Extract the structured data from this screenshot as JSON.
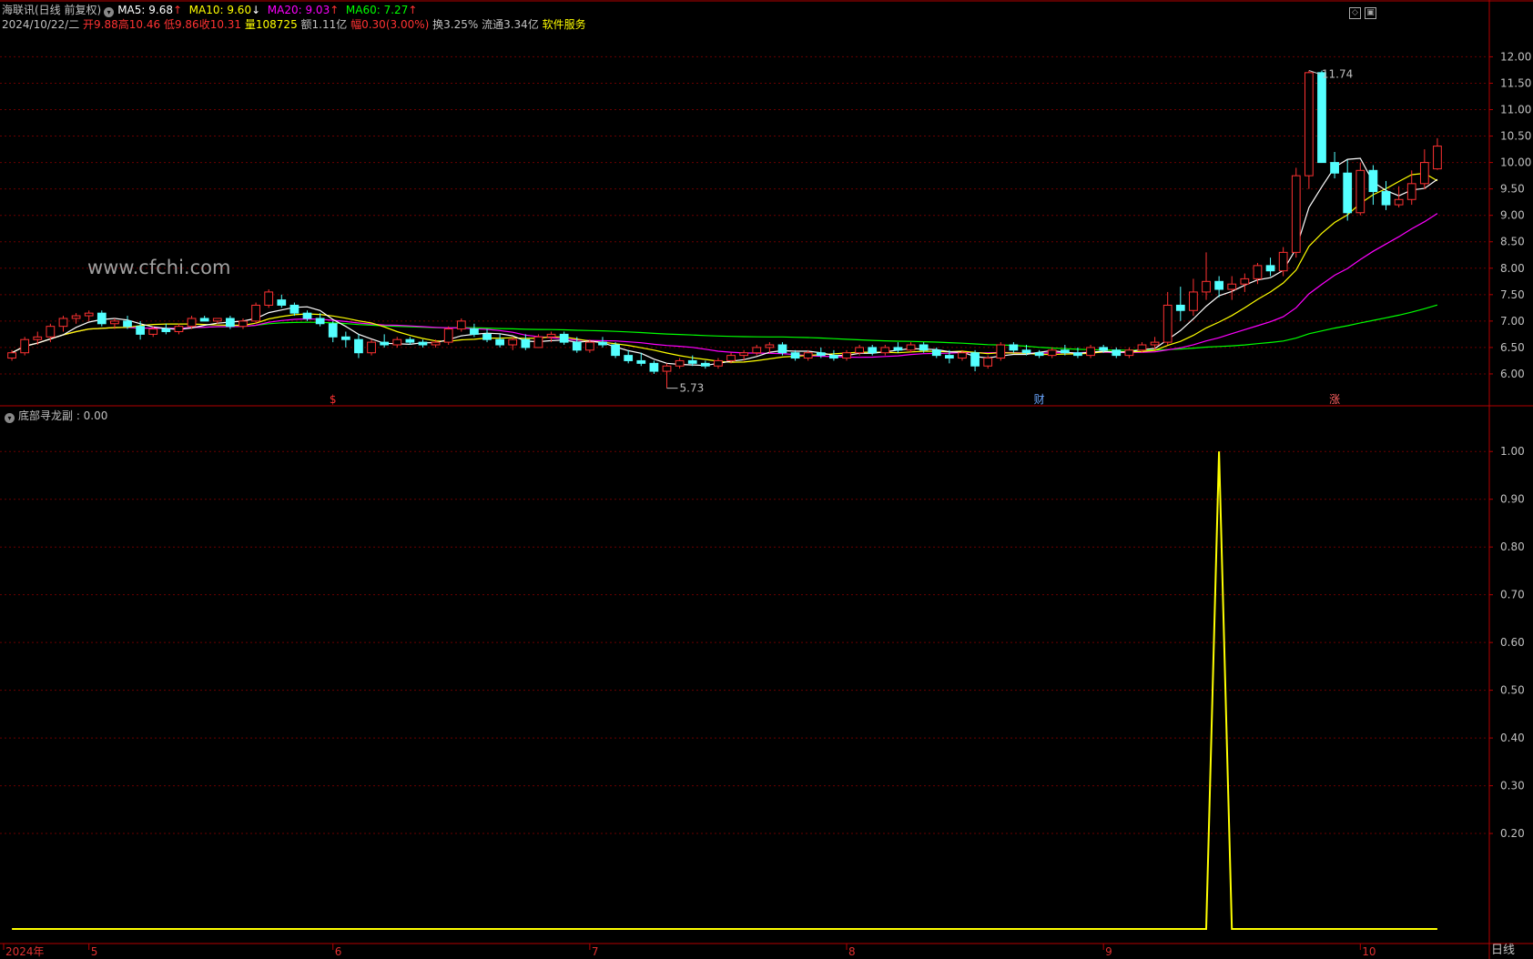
{
  "header": {
    "security": "海联讯(日线 前复权)",
    "ma5": {
      "label": "MA5: 9.68",
      "arrow": "↑",
      "color": "#ffffff"
    },
    "ma10": {
      "label": "MA10: 9.60",
      "arrow": "↓",
      "color": "#ffff00"
    },
    "ma20": {
      "label": "MA20: 9.03",
      "arrow": "↑",
      "color": "#ff00ff"
    },
    "ma60": {
      "label": "MA60: 7.27",
      "arrow": "↑",
      "color": "#00ff00"
    },
    "date": "2024/10/22/二",
    "open": "开9.88",
    "high": "高10.46",
    "low": "低9.86",
    "close": "收10.31",
    "volume": "量108725",
    "amount": "额1.11亿",
    "change": "幅0.30(3.00%)",
    "turnover": "换3.25%",
    "float": "流通3.34亿",
    "service": "软件服务"
  },
  "watermark": "www.cfchi.com",
  "annotations": {
    "max_label": "11.74",
    "min_label": "5.73",
    "event_s": "$",
    "event_cai": "财",
    "event_zhang": "涨"
  },
  "sub_panel": {
    "title": "底部寻龙副 : 0.00"
  },
  "period_label": "日线",
  "colors": {
    "up": "#ff3232",
    "down": "#54ffff",
    "ma5": "#ffffff",
    "ma10": "#ffff00",
    "ma20": "#ff00ff",
    "ma60": "#00ff00",
    "signal": "#ffff00",
    "axis": "#b40000"
  },
  "chart_data": [
    {
      "type": "candlestick",
      "title": "海联讯(日线 前复权)",
      "ylim": [
        5.5,
        12.3
      ],
      "y_ticks": [
        "12.00",
        "11.50",
        "11.00",
        "10.50",
        "10.00",
        "9.50",
        "9.00",
        "8.50",
        "8.00",
        "7.50",
        "7.00",
        "6.50",
        "6.00"
      ],
      "x_ticks": [
        "2024年",
        "5",
        "6",
        "7",
        "8",
        "9",
        "10"
      ],
      "x_tick_index": [
        0,
        6,
        25,
        45,
        65,
        85,
        105
      ],
      "ohlc": [
        [
          6.3,
          6.45,
          6.25,
          6.4
        ],
        [
          6.4,
          6.7,
          6.35,
          6.65
        ],
        [
          6.65,
          6.8,
          6.55,
          6.7
        ],
        [
          6.7,
          6.95,
          6.6,
          6.9
        ],
        [
          6.9,
          7.1,
          6.8,
          7.05
        ],
        [
          7.05,
          7.15,
          6.95,
          7.1
        ],
        [
          7.1,
          7.2,
          7.0,
          7.15
        ],
        [
          7.15,
          7.2,
          6.9,
          6.95
        ],
        [
          6.95,
          7.05,
          6.85,
          7.0
        ],
        [
          7.0,
          7.1,
          6.85,
          6.9
        ],
        [
          6.9,
          7.0,
          6.65,
          6.75
        ],
        [
          6.75,
          6.9,
          6.7,
          6.85
        ],
        [
          6.85,
          6.95,
          6.75,
          6.8
        ],
        [
          6.8,
          6.95,
          6.75,
          6.9
        ],
        [
          6.9,
          7.1,
          6.85,
          7.05
        ],
        [
          7.05,
          7.1,
          7.0,
          7.0
        ],
        [
          7.0,
          7.05,
          6.95,
          7.05
        ],
        [
          7.05,
          7.1,
          6.85,
          6.9
        ],
        [
          6.9,
          7.05,
          6.85,
          7.0
        ],
        [
          7.0,
          7.35,
          6.95,
          7.3
        ],
        [
          7.3,
          7.6,
          7.25,
          7.55
        ],
        [
          7.4,
          7.5,
          7.25,
          7.3
        ],
        [
          7.3,
          7.35,
          7.1,
          7.15
        ],
        [
          7.15,
          7.2,
          7.0,
          7.05
        ],
        [
          7.05,
          7.15,
          6.9,
          6.95
        ],
        [
          6.95,
          7.0,
          6.6,
          6.7
        ],
        [
          6.7,
          6.8,
          6.5,
          6.65
        ],
        [
          6.65,
          6.75,
          6.3,
          6.4
        ],
        [
          6.4,
          6.65,
          6.35,
          6.6
        ],
        [
          6.6,
          6.75,
          6.5,
          6.55
        ],
        [
          6.55,
          6.7,
          6.5,
          6.65
        ],
        [
          6.65,
          6.7,
          6.55,
          6.6
        ],
        [
          6.6,
          6.65,
          6.5,
          6.55
        ],
        [
          6.55,
          6.65,
          6.5,
          6.6
        ],
        [
          6.6,
          6.9,
          6.55,
          6.85
        ],
        [
          6.85,
          7.05,
          6.8,
          7.0
        ],
        [
          6.85,
          6.95,
          6.7,
          6.75
        ],
        [
          6.75,
          6.85,
          6.6,
          6.65
        ],
        [
          6.65,
          6.75,
          6.5,
          6.55
        ],
        [
          6.55,
          6.7,
          6.45,
          6.65
        ],
        [
          6.65,
          6.75,
          6.45,
          6.5
        ],
        [
          6.5,
          6.75,
          6.5,
          6.7
        ],
        [
          6.7,
          6.8,
          6.6,
          6.75
        ],
        [
          6.75,
          6.8,
          6.55,
          6.6
        ],
        [
          6.6,
          6.7,
          6.4,
          6.45
        ],
        [
          6.45,
          6.65,
          6.4,
          6.6
        ],
        [
          6.6,
          6.7,
          6.5,
          6.55
        ],
        [
          6.55,
          6.6,
          6.3,
          6.35
        ],
        [
          6.35,
          6.45,
          6.2,
          6.25
        ],
        [
          6.25,
          6.4,
          6.15,
          6.2
        ],
        [
          6.2,
          6.25,
          6.0,
          6.05
        ],
        [
          6.05,
          6.2,
          5.73,
          6.15
        ],
        [
          6.15,
          6.3,
          6.1,
          6.25
        ],
        [
          6.25,
          6.35,
          6.15,
          6.2
        ],
        [
          6.2,
          6.25,
          6.1,
          6.15
        ],
        [
          6.15,
          6.3,
          6.1,
          6.25
        ],
        [
          6.25,
          6.4,
          6.2,
          6.35
        ],
        [
          6.35,
          6.45,
          6.25,
          6.4
        ],
        [
          6.4,
          6.55,
          6.35,
          6.5
        ],
        [
          6.5,
          6.6,
          6.4,
          6.55
        ],
        [
          6.55,
          6.6,
          6.35,
          6.4
        ],
        [
          6.4,
          6.45,
          6.25,
          6.3
        ],
        [
          6.3,
          6.45,
          6.25,
          6.4
        ],
        [
          6.4,
          6.5,
          6.3,
          6.35
        ],
        [
          6.35,
          6.45,
          6.25,
          6.3
        ],
        [
          6.3,
          6.45,
          6.25,
          6.4
        ],
        [
          6.4,
          6.55,
          6.35,
          6.5
        ],
        [
          6.5,
          6.55,
          6.35,
          6.4
        ],
        [
          6.4,
          6.55,
          6.35,
          6.5
        ],
        [
          6.5,
          6.6,
          6.4,
          6.45
        ],
        [
          6.45,
          6.6,
          6.4,
          6.55
        ],
        [
          6.55,
          6.6,
          6.4,
          6.45
        ],
        [
          6.45,
          6.5,
          6.3,
          6.35
        ],
        [
          6.35,
          6.45,
          6.2,
          6.3
        ],
        [
          6.3,
          6.45,
          6.25,
          6.4
        ],
        [
          6.4,
          6.45,
          6.05,
          6.15
        ],
        [
          6.15,
          6.35,
          6.1,
          6.3
        ],
        [
          6.3,
          6.6,
          6.25,
          6.55
        ],
        [
          6.55,
          6.6,
          6.4,
          6.45
        ],
        [
          6.45,
          6.55,
          6.35,
          6.4
        ],
        [
          6.4,
          6.45,
          6.3,
          6.35
        ],
        [
          6.35,
          6.5,
          6.3,
          6.45
        ],
        [
          6.45,
          6.55,
          6.35,
          6.4
        ],
        [
          6.4,
          6.5,
          6.3,
          6.35
        ],
        [
          6.35,
          6.55,
          6.3,
          6.5
        ],
        [
          6.5,
          6.55,
          6.4,
          6.45
        ],
        [
          6.45,
          6.5,
          6.3,
          6.35
        ],
        [
          6.35,
          6.5,
          6.3,
          6.45
        ],
        [
          6.45,
          6.6,
          6.4,
          6.55
        ],
        [
          6.55,
          6.7,
          6.45,
          6.6
        ],
        [
          6.6,
          7.55,
          6.55,
          7.3
        ],
        [
          7.3,
          7.65,
          7.0,
          7.2
        ],
        [
          7.2,
          7.8,
          7.1,
          7.55
        ],
        [
          7.55,
          8.3,
          7.4,
          7.75
        ],
        [
          7.75,
          7.85,
          7.45,
          7.6
        ],
        [
          7.6,
          7.85,
          7.4,
          7.7
        ],
        [
          7.7,
          7.9,
          7.55,
          7.8
        ],
        [
          7.8,
          8.1,
          7.7,
          8.05
        ],
        [
          8.05,
          8.2,
          7.85,
          7.95
        ],
        [
          7.95,
          8.4,
          7.85,
          8.3
        ],
        [
          8.3,
          9.9,
          8.2,
          9.75
        ],
        [
          9.75,
          11.74,
          9.5,
          11.7
        ],
        [
          11.7,
          11.74,
          10.0,
          10.0
        ],
        [
          10.0,
          10.2,
          9.7,
          9.8
        ],
        [
          9.8,
          10.05,
          8.9,
          9.05
        ],
        [
          9.05,
          10.0,
          9.0,
          9.85
        ],
        [
          9.85,
          9.95,
          9.2,
          9.45
        ],
        [
          9.45,
          9.65,
          9.1,
          9.2
        ],
        [
          9.2,
          9.55,
          9.15,
          9.3
        ],
        [
          9.3,
          9.85,
          9.2,
          9.6
        ],
        [
          9.6,
          10.25,
          9.5,
          10.0
        ],
        [
          9.88,
          10.46,
          9.86,
          10.31
        ]
      ]
    },
    {
      "type": "line",
      "title": "底部寻龙副",
      "ylim": [
        0,
        1.05
      ],
      "y_ticks": [
        "1.00",
        "0.90",
        "0.80",
        "0.70",
        "0.60",
        "0.50",
        "0.40",
        "0.30",
        "0.20"
      ],
      "signal_index": 94,
      "values_note": "zero everywhere except 1.00 at signal_index"
    }
  ]
}
